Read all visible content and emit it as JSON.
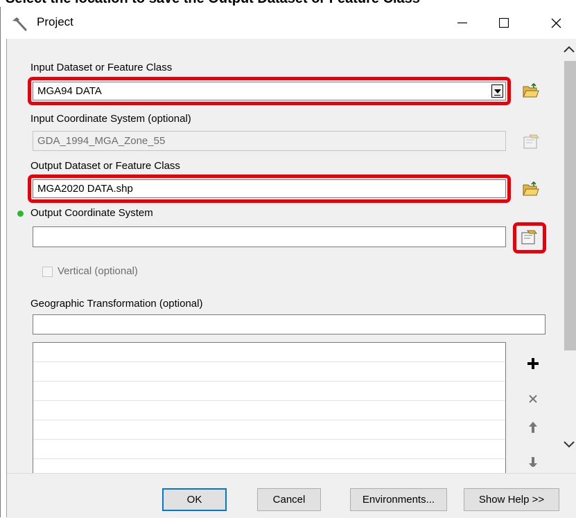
{
  "caption": "Select the location to save the Output Dataset or Feature Class",
  "window": {
    "title": "Project",
    "minimize_glyph": "—",
    "maximize_glyph": "☐",
    "close_glyph": "✕"
  },
  "form": {
    "input_dataset_label": "Input Dataset or Feature Class",
    "input_dataset_value": "MGA94 DATA",
    "input_cs_label": "Input Coordinate System (optional)",
    "input_cs_value": "GDA_1994_MGA_Zone_55",
    "output_dataset_label": "Output Dataset or Feature Class",
    "output_dataset_value": "MGA2020 DATA.shp",
    "output_cs_label": "Output Coordinate System",
    "output_cs_value": "",
    "vertical_label": "Vertical (optional)",
    "geo_transform_label": "Geographic Transformation (optional)",
    "geo_transform_value": ""
  },
  "footer": {
    "ok": "OK",
    "cancel": "Cancel",
    "environments": "Environments...",
    "show_help": "Show Help >>"
  },
  "icons": {
    "title": "hammer-icon",
    "browse": "open-folder-icon",
    "spatial_ref": "spatial-reference-properties-icon",
    "required_dot": "green-required-indicator",
    "add": "plus-icon",
    "remove": "x-icon",
    "up": "arrow-up-icon",
    "down": "arrow-down-icon"
  },
  "colors": {
    "highlight": "#e8000b",
    "required_dot": "#2db82d",
    "default_button_border": "#0078d7"
  }
}
